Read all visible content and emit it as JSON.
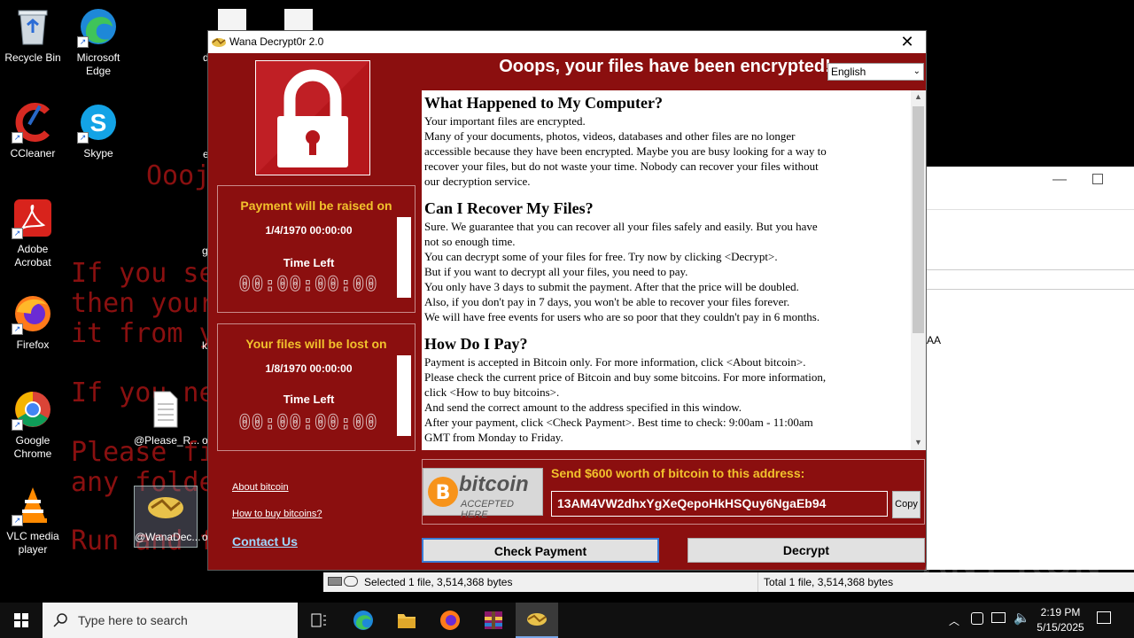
{
  "desktop": {
    "background_lines": [
      "Oooj",
      "If you se",
      "then your",
      "it from y",
      "If you ne",
      "Please fi",
      "any folde",
      "Run and f"
    ],
    "icons": [
      {
        "label": "Recycle Bin",
        "icon": "recycle-bin-icon"
      },
      {
        "label": "Microsoft Edge",
        "icon": "edge-icon"
      },
      {
        "label": "CCleaner",
        "icon": "ccleaner-icon"
      },
      {
        "label": "Skype",
        "icon": "skype-icon"
      },
      {
        "label": "Adobe Acrobat",
        "icon": "acrobat-icon"
      },
      {
        "label": "Firefox",
        "icon": "firefox-icon"
      },
      {
        "label": "Google Chrome",
        "icon": "chrome-icon"
      },
      {
        "label": "VLC media player",
        "icon": "vlc-icon"
      },
      {
        "label": "@Please_R...",
        "icon": "text-file-icon"
      },
      {
        "label": "@WanaDec...",
        "icon": "wanadecryptor-icon"
      }
    ],
    "partial_labels": [
      "d",
      "e",
      "g",
      "k",
      "o",
      "o"
    ],
    "explorer_partial_text": "AA"
  },
  "wana": {
    "title": "Wana Decrypt0r 2.0",
    "headline": "Ooops, your files have been encrypted!",
    "language": "English",
    "panel1": {
      "heading": "Payment will be raised on",
      "date": "1/4/1970 00:00:00",
      "time_left_label": "Time Left",
      "timer": "00:00:00:00"
    },
    "panel2": {
      "heading": "Your files will be lost on",
      "date": "1/8/1970 00:00:00",
      "time_left_label": "Time Left",
      "timer": "00:00:00:00"
    },
    "links": {
      "about_bitcoin": "About bitcoin",
      "how_to_buy": "How to buy bitcoins?",
      "contact": "Contact Us"
    },
    "message": {
      "h1": "What Happened to My Computer?",
      "p1": [
        "Your important files are encrypted.",
        "Many of your documents, photos, videos, databases and other files are no longer",
        "accessible because they have been encrypted. Maybe you are busy looking for a way to",
        "recover your files, but do not waste your time. Nobody can recover your files without",
        "our decryption service."
      ],
      "h2": "Can I Recover My Files?",
      "p2": [
        "Sure. We guarantee that you can recover all your files safely and easily. But you have",
        "not so enough time.",
        "You can decrypt some of your files for free. Try now by clicking <Decrypt>.",
        "But if you want to decrypt all your files, you need to pay.",
        "You only have 3 days to submit the payment. After that the price will be doubled.",
        "Also, if you don't pay in 7 days, you won't be able to recover your files forever.",
        "We will have free events for users who are so poor that they couldn't pay in 6 months."
      ],
      "h3": "How Do I Pay?",
      "p3": [
        "Payment is accepted in Bitcoin only. For more information, click <About bitcoin>.",
        "Please check the current price of Bitcoin and buy some bitcoins. For more information,",
        "click <How to buy bitcoins>.",
        "And send the correct amount to the address specified in this window.",
        "After your payment, click <Check Payment>. Best time to check: 9:00am - 11:00am",
        "GMT from Monday to Friday."
      ]
    },
    "bitcoin": {
      "logo_word": "bitcoin",
      "logo_sub": "ACCEPTED HERE",
      "send_label": "Send $600 worth of bitcoin to this address:",
      "address": "13AM4VW2dhxYgXeQepoHkHSQuy6NgaEb94",
      "copy": "Copy"
    },
    "buttons": {
      "check_payment": "Check Payment",
      "decrypt": "Decrypt"
    }
  },
  "statusbar": {
    "left": "Selected 1 file, 3,514,368 bytes",
    "right": "Total 1 file, 3,514,368 bytes"
  },
  "taskbar": {
    "search_placeholder": "Type here to search",
    "time": "2:19 PM",
    "date": "5/15/2025"
  },
  "watermark": "ANY RUN",
  "colors": {
    "window_red": "#8b0f0f",
    "accent_yellow": "#f2c22c",
    "lock_red": "#b5161b"
  }
}
